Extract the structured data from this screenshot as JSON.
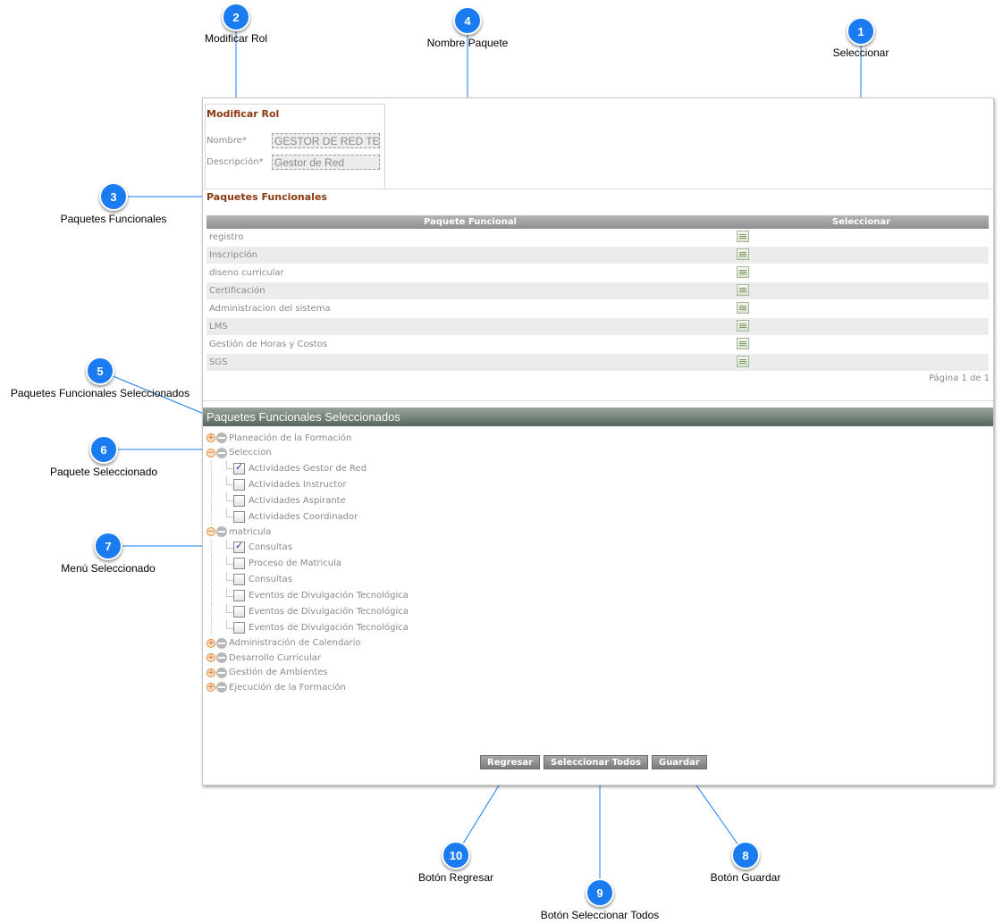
{
  "callouts": [
    {
      "number": "1",
      "label": "Seleccionar"
    },
    {
      "number": "2",
      "label": "Modificar Rol"
    },
    {
      "number": "3",
      "label": "Paquetes Funcionales"
    },
    {
      "number": "4",
      "label": "Nombre Paquete"
    },
    {
      "number": "5",
      "label": "Paquetes Funcionales Seleccionados"
    },
    {
      "number": "6",
      "label": "Paquete Seleccionado"
    },
    {
      "number": "7",
      "label": "Menú Seleccionado"
    },
    {
      "number": "8",
      "label": "Botón Guardar"
    },
    {
      "number": "9",
      "label": "Botón Seleccionar Todos"
    },
    {
      "number": "10",
      "label": "Botón Regresar"
    }
  ],
  "rol": {
    "title": "Modificar Rol",
    "nombre_label": "Nombre*",
    "nombre_value": "GESTOR DE RED TECNOLOGICA",
    "descripcion_label": "Descripción*",
    "descripcion_value": "Gestor de Red"
  },
  "paquetes": {
    "title": "Paquetes Funcionales",
    "columns": [
      "Paquete Funcional",
      "Seleccionar"
    ],
    "rows": [
      "registro",
      "Inscripción",
      "diseno curricular",
      "Certificación",
      "Administracion del sistema",
      "LMS",
      "Gestión de Horas y Costos",
      "SGS"
    ],
    "icon": "select-edit-icon",
    "pager": "Página 1 de 1"
  },
  "seleccionados": {
    "title": "Paquetes Funcionales Seleccionados",
    "groups": [
      {
        "label": "Planeación de la Formación",
        "expanded": false,
        "items": []
      },
      {
        "label": "Seleccion",
        "expanded": true,
        "items": [
          {
            "label": "Actividades Gestor de Red",
            "checked": true
          },
          {
            "label": "Actividades Instructor",
            "checked": false
          },
          {
            "label": "Actividades Aspirante",
            "checked": false
          },
          {
            "label": "Actividades Coordinador",
            "checked": false
          }
        ]
      },
      {
        "label": "matricula",
        "expanded": true,
        "items": [
          {
            "label": "Consultas",
            "checked": true
          },
          {
            "label": "Proceso de Matricula",
            "checked": false
          },
          {
            "label": "Consultas",
            "checked": false
          },
          {
            "label": "Eventos de Divulgación Tecnológica",
            "checked": false
          },
          {
            "label": "Eventos de Divulgación Tecnológica",
            "checked": false
          },
          {
            "label": "Eventos de Divulgación Tecnológica",
            "checked": false
          }
        ]
      },
      {
        "label": "Administración de Calendario",
        "expanded": false,
        "items": []
      },
      {
        "label": "Desarrollo Curricular",
        "expanded": false,
        "items": []
      },
      {
        "label": "Gestión de Ambientes",
        "expanded": false,
        "items": []
      },
      {
        "label": "Ejecución de la Formación",
        "expanded": false,
        "items": []
      }
    ]
  },
  "buttons": {
    "regresar": "Regresar",
    "seleccionar_todos": "Seleccionar Todos",
    "guardar": "Guardar"
  },
  "colors": {
    "callout": "#1a7cf0",
    "leader_line": "#1a7cf0",
    "section_title": "#8b3a10",
    "header_bar": "#56655a",
    "button": "#8c8c8c"
  }
}
